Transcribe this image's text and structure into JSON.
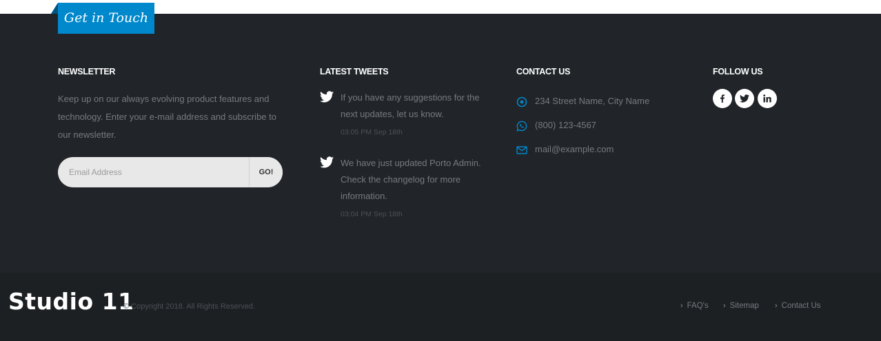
{
  "header": {
    "ribbon_label": "Get in Touch"
  },
  "newsletter": {
    "title": "NEWSLETTER",
    "description": "Keep up on our always evolving product features and technology. Enter your e-mail address and subscribe to our newsletter.",
    "email_placeholder": "Email Address",
    "submit_label": "GO!"
  },
  "tweets": {
    "title": "LATEST TWEETS",
    "items": [
      {
        "text": "If you have any suggestions for the next updates, let us know.",
        "date": "03:05 PM Sep 18th",
        "icon": "twitter-icon"
      },
      {
        "text": "We have just updated Porto Admin. Check the changelog for more information.",
        "date": "03:04 PM Sep 18th",
        "icon": "twitter-icon"
      }
    ]
  },
  "contact": {
    "title": "CONTACT US",
    "items": [
      {
        "text": "234 Street Name, City Name",
        "icon": "location-dot-icon"
      },
      {
        "text": "(800) 123-4567",
        "icon": "whatsapp-icon"
      },
      {
        "text": "mail@example.com",
        "icon": "envelope-icon"
      }
    ]
  },
  "follow": {
    "title": "FOLLOW US",
    "networks": [
      {
        "name": "facebook",
        "icon": "facebook-icon"
      },
      {
        "name": "twitter",
        "icon": "twitter-icon"
      },
      {
        "name": "linkedin",
        "icon": "linkedin-icon"
      }
    ]
  },
  "bottom": {
    "logo": "Studio 11",
    "copyright": "© Copyright 2018. All Rights Reserved.",
    "links": [
      {
        "label": "FAQ's"
      },
      {
        "label": "Sitemap"
      },
      {
        "label": "Contact Us"
      }
    ]
  },
  "colors": {
    "accent": "#0088cc",
    "footer_bg": "#212529",
    "copyright_bg": "#1c2023",
    "text_muted": "#777b80"
  }
}
